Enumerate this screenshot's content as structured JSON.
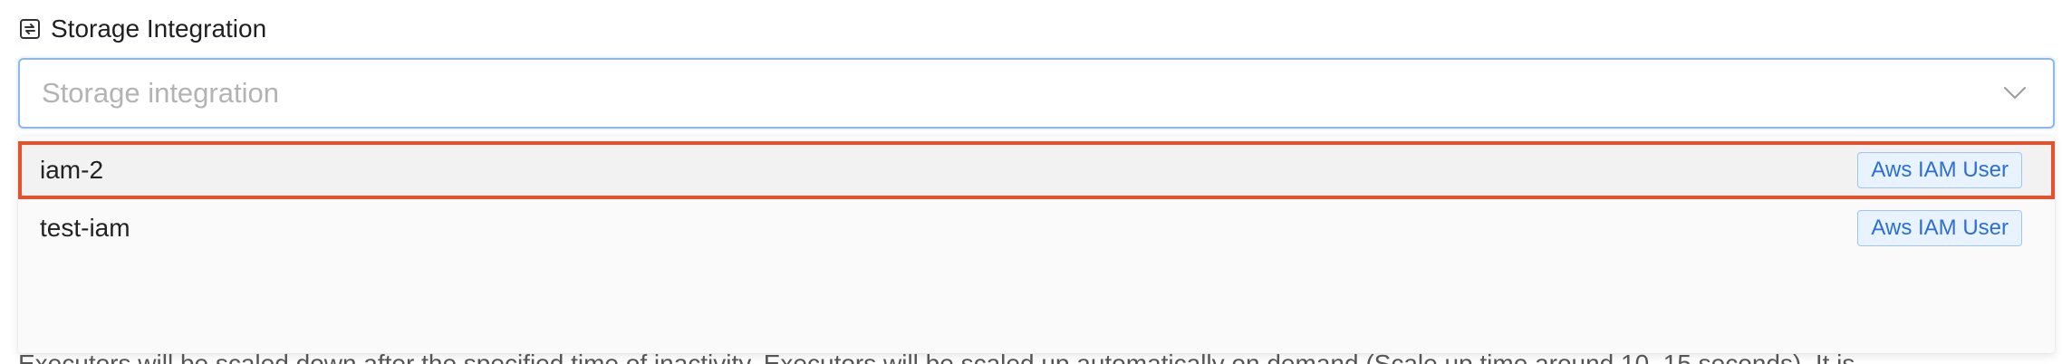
{
  "section": {
    "icon": "sync-icon",
    "title": "Storage Integration"
  },
  "select": {
    "placeholder": "Storage integration",
    "chevron_icon": "chevron-down-icon"
  },
  "dropdown": {
    "options": [
      {
        "label": "iam-2",
        "tag": "Aws IAM User",
        "highlighted": true
      },
      {
        "label": "test-iam",
        "tag": "Aws IAM User",
        "highlighted": false
      }
    ]
  },
  "footer": {
    "text": "Executors will be scaled down after the specified time of inactivity. Executors will be scaled up automatically on demand (Scale up time around 10–15 seconds). It is"
  },
  "colors": {
    "focus_border": "#8ab8f0",
    "highlight_outline": "#e5512b",
    "tag_text": "#2b6fd6",
    "tag_bg": "#e8f3ff"
  }
}
